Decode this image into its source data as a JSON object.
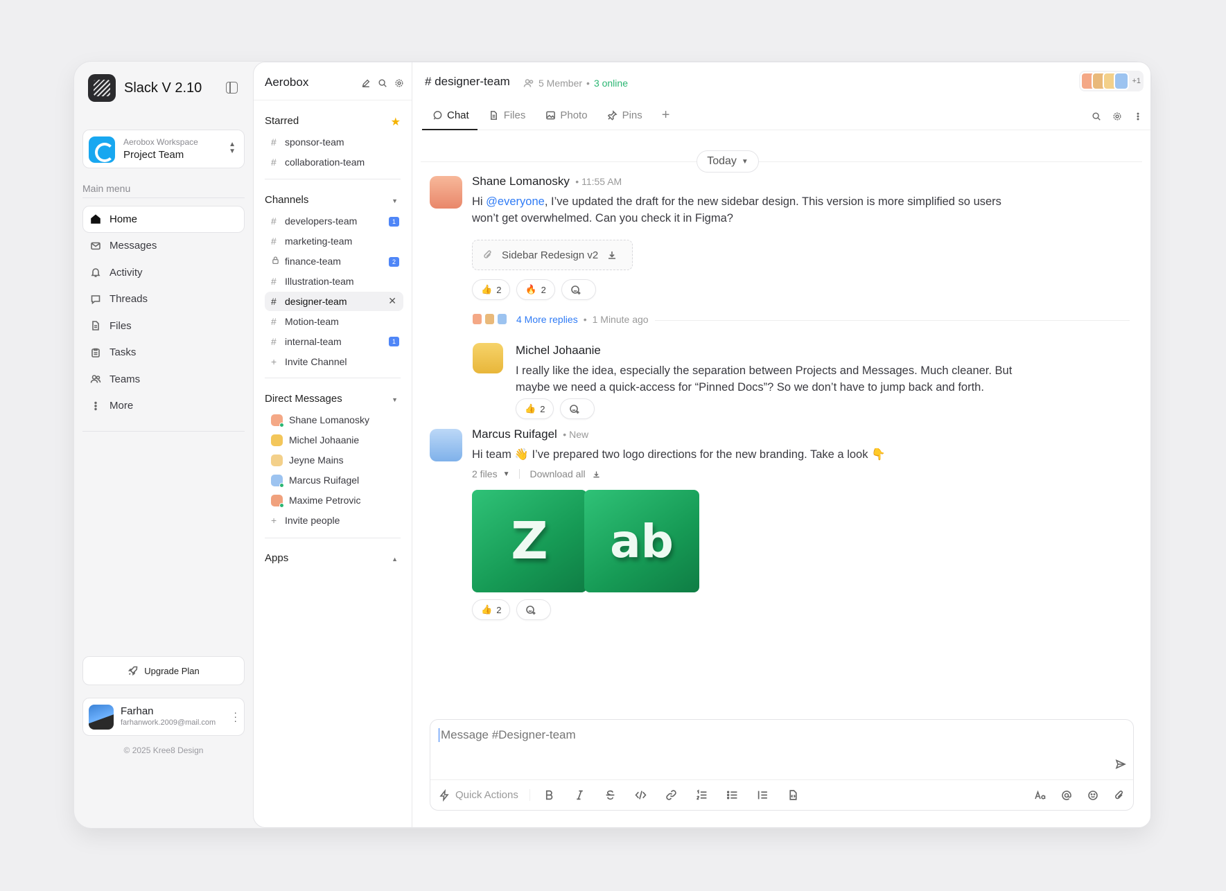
{
  "app": {
    "title": "Slack V 2.10"
  },
  "workspace": {
    "subtitle": "Aerobox Workspace",
    "name": "Project Team"
  },
  "main_menu": {
    "label": "Main menu",
    "items": [
      {
        "label": "Home",
        "icon": "home-icon"
      },
      {
        "label": "Messages",
        "icon": "mail-icon"
      },
      {
        "label": "Activity",
        "icon": "bell-icon"
      },
      {
        "label": "Threads",
        "icon": "chat-bubble-icon"
      },
      {
        "label": "Files",
        "icon": "file-icon"
      },
      {
        "label": "Tasks",
        "icon": "clipboard-icon"
      },
      {
        "label": "Teams",
        "icon": "users-icon"
      },
      {
        "label": "More",
        "icon": "more-vertical-icon"
      }
    ]
  },
  "upgrade": {
    "label": "Upgrade Plan"
  },
  "user": {
    "name": "Farhan",
    "email": "farhanwork.2009@mail.com"
  },
  "footer": {
    "copyright": "© 2025 Kree8 Design"
  },
  "channels_panel": {
    "title": "Aerobox",
    "starred": {
      "label": "Starred",
      "items": [
        "sponsor-team",
        "collaboration-team"
      ]
    },
    "channels": {
      "label": "Channels",
      "items": [
        {
          "name": "developers-team",
          "badge": "1",
          "locked": false
        },
        {
          "name": "marketing-team",
          "badge": "",
          "locked": false
        },
        {
          "name": "finance-team",
          "badge": "2",
          "locked": true
        },
        {
          "name": "Illustration-team",
          "badge": "",
          "locked": false
        },
        {
          "name": "designer-team",
          "badge": "",
          "locked": false,
          "selected": true
        },
        {
          "name": "Motion-team",
          "badge": "",
          "locked": false
        },
        {
          "name": "internal-team",
          "badge": "1",
          "locked": false
        }
      ],
      "invite": "Invite Channel"
    },
    "direct_messages": {
      "label": "Direct Messages",
      "items": [
        {
          "name": "Shane Lomanosky",
          "color": "#f4a886"
        },
        {
          "name": "Michel Johaanie",
          "color": "#f3c65a"
        },
        {
          "name": "Jeyne Mains",
          "color": "#f3d08a"
        },
        {
          "name": "Marcus Ruifagel",
          "color": "#9cc3f0"
        },
        {
          "name": "Maxime Petrovic",
          "color": "#f0a17d"
        }
      ],
      "invite": "Invite people"
    },
    "apps": {
      "label": "Apps"
    }
  },
  "channel": {
    "title": "# designer-team",
    "members": "5 Member",
    "online": "3 online",
    "extra_members": "+1",
    "tabs": [
      "Chat",
      "Files",
      "Photo",
      "Pins"
    ]
  },
  "date_divider": "Today",
  "messages": [
    {
      "author": "Shane Lomanosky",
      "time": "11:55 AM",
      "text_before": "Hi ",
      "mention": "@everyone",
      "text_after": ", I’ve updated the draft for the new sidebar design. This version is more simplified so users won’t get overwhelmed. Can you check it in Figma?",
      "attachment": "Sidebar Redesign v2",
      "reactions": [
        {
          "emoji": "👍",
          "count": "2"
        },
        {
          "emoji": "🔥",
          "count": "2"
        }
      ],
      "thread": {
        "more_replies": "4 More replies",
        "ago": "1 Minute ago"
      }
    },
    {
      "author": "Michel Johaanie",
      "text": "I really like the idea, especially the separation between Projects and Messages. Much cleaner. But maybe we need a quick-access for “Pinned Docs”? So we don’t have to jump back and forth.",
      "reactions": [
        {
          "emoji": "👍",
          "count": "2"
        }
      ]
    },
    {
      "author": "Marcus Ruifagel",
      "time": "New",
      "text": "Hi team 👋  I’ve prepared two logo directions for the new branding. Take a look 👇",
      "files_count": "2 files",
      "download_all": "Download all",
      "reactions": [
        {
          "emoji": "👍",
          "count": "2"
        }
      ]
    }
  ],
  "composer": {
    "placeholder": "Message #Designer-team",
    "quick_actions": "Quick Actions"
  }
}
